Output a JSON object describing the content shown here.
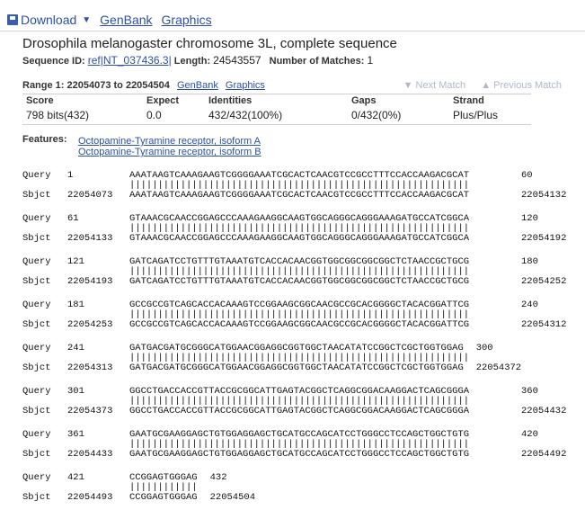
{
  "toolbar": {
    "download_label": "Download",
    "genbank_label": "GenBank",
    "graphics_label": "Graphics"
  },
  "title": "Drosophila melanogaster chromosome 3L, complete sequence",
  "seqinfo": {
    "id_label": "Sequence ID:",
    "id_value": "ref|NT_037436.3|",
    "length_label": "Length:",
    "length_value": "24543557",
    "matches_label": "Number of Matches:",
    "matches_value": "1"
  },
  "range": {
    "label": "Range 1: 22054073 to 22054504",
    "genbank_label": "GenBank",
    "graphics_label": "Graphics",
    "next_label": "▼ Next Match",
    "prev_label": "▲ Previous Match"
  },
  "summary": {
    "headers": [
      "Score",
      "Expect",
      "Identities",
      "Gaps",
      "Strand"
    ],
    "values": [
      "798 bits(432)",
      "0.0",
      "432/432(100%)",
      "0/432(0%)",
      "Plus/Plus"
    ]
  },
  "features": {
    "label": "Features:",
    "items": [
      "Octopamine-Tyramine receptor, isoform A",
      "Octopamine-Tyramine receptor, isoform B"
    ]
  },
  "alignment": [
    {
      "q_start": "1",
      "q_seq": "AAATAAGTCAAAGAAGTCGGGGAAATCGCACTCAACGTCCGCCTTTCCACCAAGACGCAT",
      "q_end": "60",
      "match": "||||||||||||||||||||||||||||||||||||||||||||||||||||||||||||",
      "s_start": "22054073",
      "s_seq": "AAATAAGTCAAAGAAGTCGGGGAAATCGCACTCAACGTCCGCCTTTCCACCAAGACGCAT",
      "s_end": "22054132"
    },
    {
      "q_start": "61",
      "q_seq": "GTAAACGCAACCGGAGCCCAAAGAAGGCAAGTGGCAGGGCAGGGAAAGATGCCATCGGCA",
      "q_end": "120",
      "match": "||||||||||||||||||||||||||||||||||||||||||||||||||||||||||||",
      "s_start": "22054133",
      "s_seq": "GTAAACGCAACCGGAGCCCAAAGAAGGCAAGTGGCAGGGCAGGGAAAGATGCCATCGGCA",
      "s_end": "22054192"
    },
    {
      "q_start": "121",
      "q_seq": "GATCAGATCCTGTTTGTAAATGTCACCACAACGGTGGCGGCGGCGGCTCTAACCGCTGCG",
      "q_end": "180",
      "match": "||||||||||||||||||||||||||||||||||||||||||||||||||||||||||||",
      "s_start": "22054193",
      "s_seq": "GATCAGATCCTGTTTGTAAATGTCACCACAACGGTGGCGGCGGCGGCTCTAACCGCTGCG",
      "s_end": "22054252"
    },
    {
      "q_start": "181",
      "q_seq": "GCCGCCGTCAGCACCACAAAGTCCGGAAGCGGCAACGCCGCACGGGGCTACACGGATTCG",
      "q_end": "240",
      "match": "||||||||||||||||||||||||||||||||||||||||||||||||||||||||||||",
      "s_start": "22054253",
      "s_seq": "GCCGCCGTCAGCACCACAAAGTCCGGAAGCGGCAACGCCGCACGGGGCTACACGGATTCG",
      "s_end": "22054312"
    },
    {
      "q_start": "241",
      "q_seq": "GATGACGATGCGGGCATGGAACGGAGGCGGTGGCTAACATATCCGGCTCGCTGGTGGAG",
      "q_end": "300",
      "match": "||||||||||||||||||||||||||||||||||||||||||||||||||||||||||||",
      "s_start": "22054313",
      "s_seq": "GATGACGATGCGGGCATGGAACGGAGGCGGTGGCTAACATATCCGGCTCGCTGGTGGAG",
      "s_end": "22054372"
    },
    {
      "q_start": "301",
      "q_seq": "GGCCTGACCACCGTTACCGCGGCATTGAGTACGGCTCAGGCGGACAAGGACTCAGCGGGA",
      "q_end": "360",
      "match": "||||||||||||||||||||||||||||||||||||||||||||||||||||||||||||",
      "s_start": "22054373",
      "s_seq": "GGCCTGACCACCGTTACCGCGGCATTGAGTACGGCTCAGGCGGACAAGGACTCAGCGGGA",
      "s_end": "22054432"
    },
    {
      "q_start": "361",
      "q_seq": "GAATGCGAAGGAGCTGTGGAGGAGCTGCATGCCAGCATCCTGGGCCTCCAGCTGGCTGTG",
      "q_end": "420",
      "match": "||||||||||||||||||||||||||||||||||||||||||||||||||||||||||||",
      "s_start": "22054433",
      "s_seq": "GAATGCGAAGGAGCTGTGGAGGAGCTGCATGCCAGCATCCTGGGCCTCCAGCTGGCTGTG",
      "s_end": "22054492"
    },
    {
      "q_start": "421",
      "q_seq": "CCGGAGTGGGAG",
      "q_end": "432",
      "match": "||||||||||||",
      "s_start": "22054493",
      "s_seq": "CCGGAGTGGGAG",
      "s_end": "22054504"
    }
  ]
}
